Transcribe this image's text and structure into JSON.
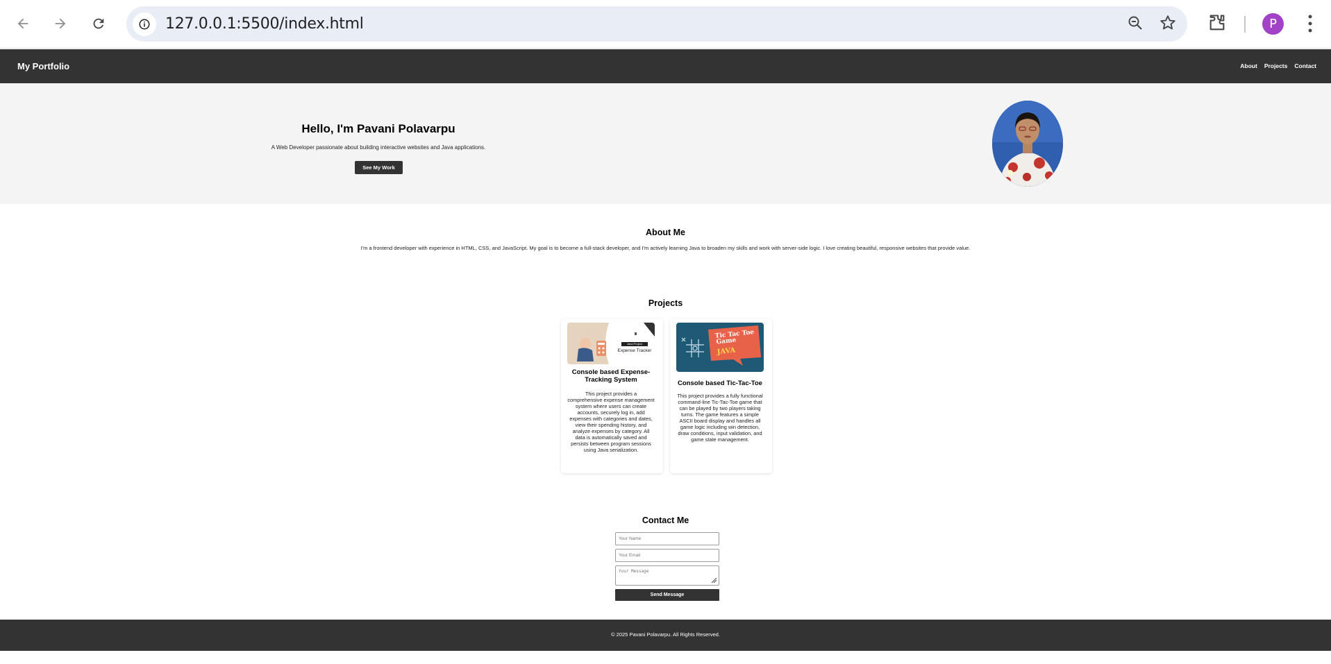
{
  "browser": {
    "url": "127.0.0.1:5500/index.html",
    "avatar_letter": "P",
    "icons": [
      "back-arrow-icon",
      "forward-arrow-icon",
      "reload-icon",
      "info-icon",
      "zoom-out-icon",
      "star-icon",
      "extensions-icon",
      "more-vert-icon"
    ]
  },
  "nav": {
    "brand": "My Portfolio",
    "links": [
      "About",
      "Projects",
      "Contact"
    ]
  },
  "hero": {
    "title": "Hello, I'm Pavani Polavarpu",
    "subtitle": "A Web Developer passionate about building interactive websites and Java applications.",
    "cta": "See My Work"
  },
  "about": {
    "title": "About Me",
    "text": "I'm a frontend developer with experience in HTML, CSS, and JavaScript. My goal is to become a full-stack developer, and I'm actively learning Java to broaden my skills and work with server-side logic. I love creating beautiful, responsive websites that provide value."
  },
  "projects": {
    "title": "Projects",
    "items": [
      {
        "title": "Console based Expense-Tracking System",
        "thumb_text": [
          "Java Project",
          "Expense Tracker"
        ],
        "description": "This project provides a comprehensive expense management system where users can create accounts, securely log in, add expenses with categories and dates, view their spending history, and analyze expenses by category. All data is automatically saved and persists between program sessions using Java serialization."
      },
      {
        "title": "Console based Tic-Tac-Toe",
        "thumb_text": [
          "Tic Tac Toe",
          "Game",
          "JAVA"
        ],
        "description": "This project provides a fully functional command-line Tic-Tac-Toe game that can be played by two players taking turns. The game features a simple ASCII board display and handles all game logic including win detection, draw conditions, input validation, and game state management."
      }
    ]
  },
  "contact": {
    "title": "Contact Me",
    "name_placeholder": "Your Name",
    "email_placeholder": "Your Email",
    "message_placeholder": "Your Message",
    "send": "Send Message"
  },
  "footer": {
    "text": "© 2025 Pavani Polavarpu. All Rights Reserved."
  }
}
